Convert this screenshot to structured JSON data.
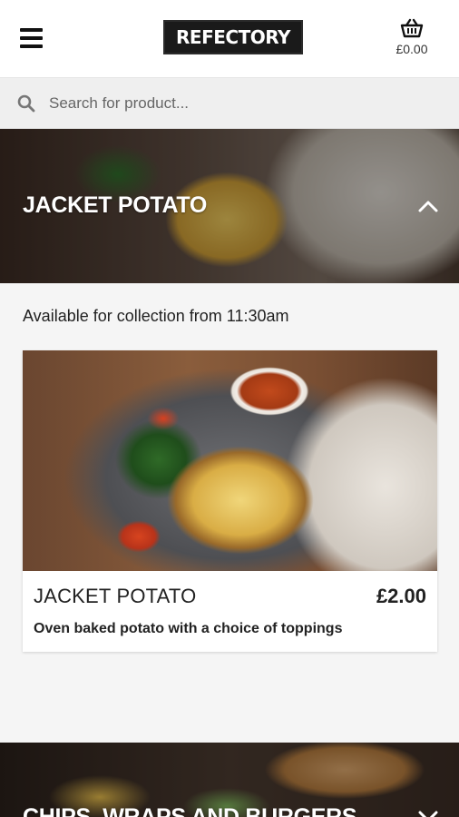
{
  "header": {
    "logo_text": "REFECTORY",
    "basket_total": "£0.00"
  },
  "search": {
    "placeholder": "Search for product..."
  },
  "categories": [
    {
      "title": "JACKET POTATO",
      "expanded": true,
      "availability": "Available for collection from 11:30am",
      "products": [
        {
          "name": "JACKET POTATO",
          "price": "£2.00",
          "description": "Oven baked potato with a choice of toppings"
        }
      ]
    },
    {
      "title": "CHIPS, WRAPS AND BURGERS",
      "expanded": false
    }
  ],
  "icons": {
    "menu": "hamburger-menu-icon",
    "basket": "basket-icon",
    "search": "search-icon",
    "collapse": "chevron-up-icon",
    "expand": "chevron-down-icon"
  }
}
